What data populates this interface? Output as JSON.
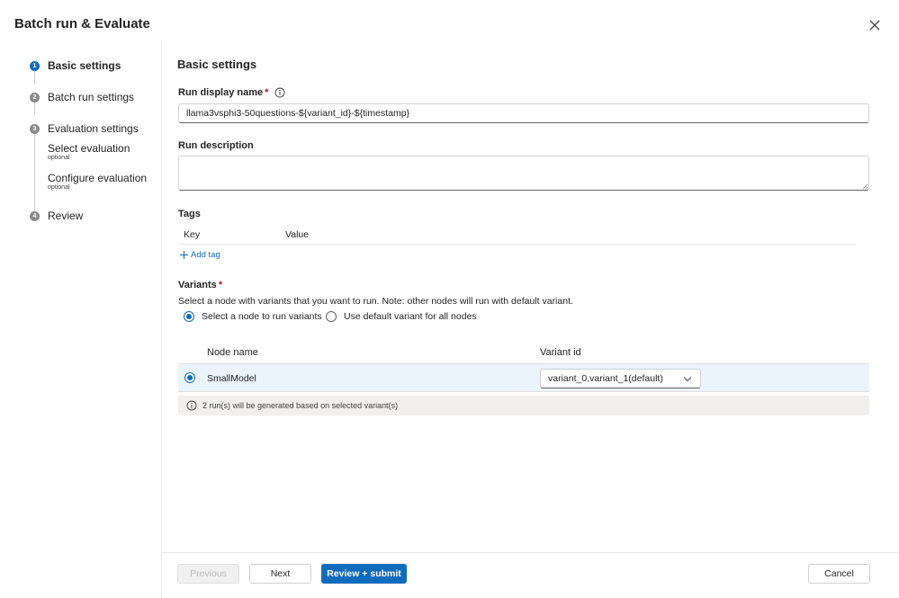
{
  "dialog": {
    "title": "Batch run & Evaluate",
    "close_icon": "close-icon"
  },
  "steps": [
    {
      "number": "1",
      "label": "Basic settings",
      "active": true
    },
    {
      "number": "2",
      "label": "Batch run settings",
      "active": false
    },
    {
      "number": "3",
      "label": "Evaluation settings",
      "active": false
    },
    {
      "number": "4",
      "label": "Review",
      "active": false
    }
  ],
  "substeps": [
    {
      "label": "Select evaluation",
      "note": "optional"
    },
    {
      "label": "Configure evaluation",
      "note": "optional"
    }
  ],
  "form": {
    "section_title": "Basic settings",
    "run_display_name": {
      "label": "Run display name",
      "required_mark": "*",
      "value": "llama3vsphi3-50questions-${variant_id}-${timestamp}"
    },
    "run_description": {
      "label": "Run description",
      "value": ""
    },
    "tags": {
      "label": "Tags",
      "col_key": "Key",
      "col_value": "Value",
      "add_label": "Add tag"
    },
    "variants": {
      "label": "Variants",
      "required_mark": "*",
      "helper": "Select a node with variants that you want to run. Note: other nodes will run with default variant.",
      "option_select_node": "Select a node to run variants",
      "option_default": "Use default variant for all nodes",
      "selected_option": "select_node",
      "grid": {
        "col_node": "Node name",
        "col_variant": "Variant id",
        "rows": [
          {
            "node_name": "SmallModel",
            "variant_id": "variant_0,variant_1(default)",
            "selected": true
          }
        ]
      },
      "info_message": "2 run(s) will be generated based on selected variant(s)"
    }
  },
  "footer": {
    "previous": "Previous",
    "next": "Next",
    "review_submit": "Review + submit",
    "cancel": "Cancel"
  },
  "colors": {
    "accent": "#0f6cbd",
    "required": "#c50f1f",
    "selected_row": "#ebf3fc",
    "info_bar": "#f1f0ef"
  }
}
